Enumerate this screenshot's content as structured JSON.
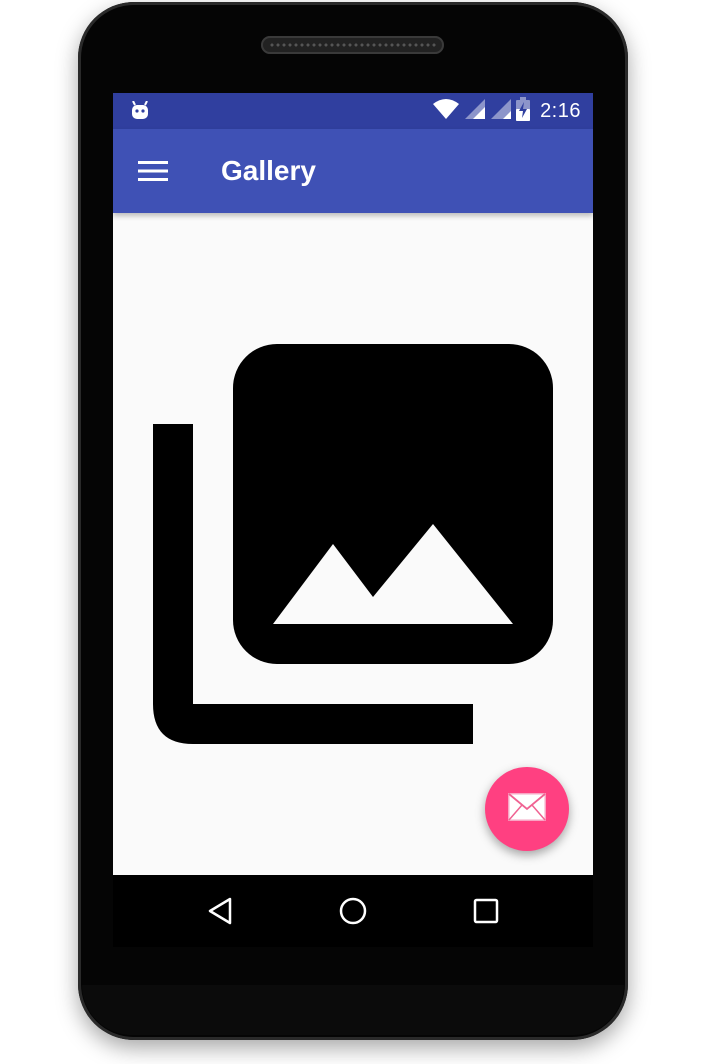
{
  "status_bar": {
    "time": "2:16",
    "notification_icon": "android-debug-icon",
    "wifi_icon": "wifi-icon",
    "signal_icons": [
      "cell-signal-icon",
      "cell-signal-icon"
    ],
    "battery_icon": "battery-charging-icon",
    "background_color": "#303f9f"
  },
  "app_bar": {
    "title": "Gallery",
    "menu_icon": "hamburger-menu-icon",
    "background_color": "#3f51b5"
  },
  "content": {
    "hero_icon": "photo-library-icon",
    "background_color": "#fafafa"
  },
  "fab": {
    "icon": "mail-icon",
    "color": "#ff4081"
  },
  "nav_bar": {
    "buttons": [
      "back-icon",
      "home-icon",
      "recents-icon"
    ]
  }
}
